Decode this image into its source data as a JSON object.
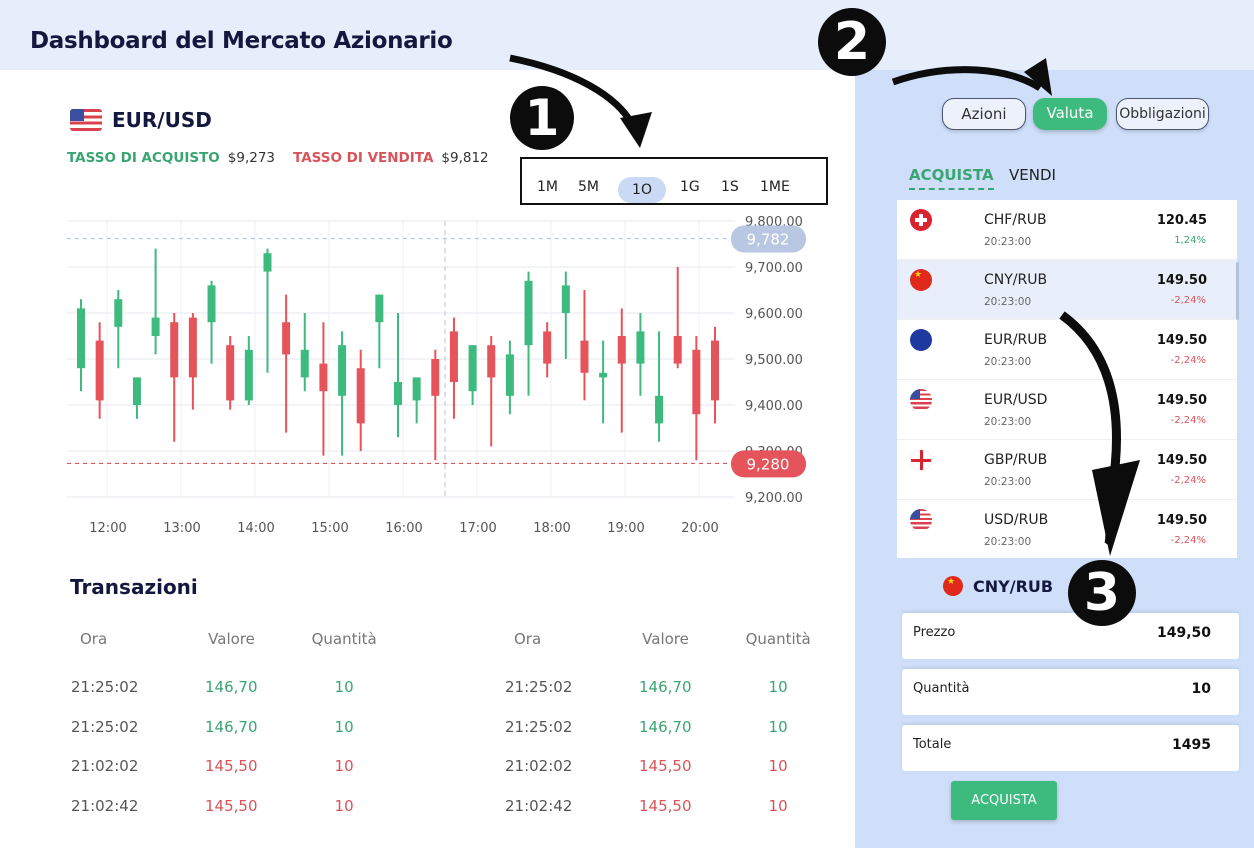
{
  "app": {
    "title": "Dashboard del Mercato Azionario"
  },
  "pair": {
    "name": "EUR/USD",
    "flag_icon": "us-flag-icon",
    "buy_label": "TASSO DI ACQUISTO",
    "buy_value": "$9,273",
    "sell_label": "TASSO DI VENDITA",
    "sell_value": "$9,812"
  },
  "timeframes": [
    {
      "label": "1M"
    },
    {
      "label": "5M"
    },
    {
      "label": "1O",
      "active": true
    },
    {
      "label": "1G"
    },
    {
      "label": "1S"
    },
    {
      "label": "1ME"
    }
  ],
  "chart_data": {
    "type": "candlestick",
    "x_tick_labels": [
      "12:00",
      "13:00",
      "14:00",
      "15:00",
      "16:00",
      "17:00",
      "18:00",
      "19:00",
      "20:00"
    ],
    "y_tick_labels": [
      "9,800.00",
      "9,700.00",
      "9,600.00",
      "9,500.00",
      "9,400.00",
      "9,300.00",
      "9,200.00"
    ],
    "ylim": [
      9200,
      9800
    ],
    "up_color": "#3dba7e",
    "down_color": "#e4545a",
    "price_markers": [
      {
        "label": "9,782",
        "value": 9762,
        "color": "#b9c8e2"
      },
      {
        "label": "9,280",
        "value": 9273,
        "color": "#e4545a"
      }
    ],
    "candles": [
      {
        "o": 9480,
        "h": 9630,
        "l": 9430,
        "c": 9610
      },
      {
        "o": 9540,
        "h": 9580,
        "l": 9370,
        "c": 9410
      },
      {
        "o": 9570,
        "h": 9650,
        "l": 9480,
        "c": 9630
      },
      {
        "o": 9400,
        "h": 9460,
        "l": 9370,
        "c": 9460
      },
      {
        "o": 9550,
        "h": 9740,
        "l": 9510,
        "c": 9590
      },
      {
        "o": 9580,
        "h": 9600,
        "l": 9320,
        "c": 9460
      },
      {
        "o": 9590,
        "h": 9600,
        "l": 9390,
        "c": 9460
      },
      {
        "o": 9580,
        "h": 9670,
        "l": 9490,
        "c": 9660
      },
      {
        "o": 9530,
        "h": 9550,
        "l": 9390,
        "c": 9410
      },
      {
        "o": 9410,
        "h": 9550,
        "l": 9400,
        "c": 9520
      },
      {
        "o": 9690,
        "h": 9740,
        "l": 9470,
        "c": 9730
      },
      {
        "o": 9580,
        "h": 9640,
        "l": 9340,
        "c": 9510
      },
      {
        "o": 9460,
        "h": 9600,
        "l": 9430,
        "c": 9520
      },
      {
        "o": 9490,
        "h": 9580,
        "l": 9290,
        "c": 9430
      },
      {
        "o": 9420,
        "h": 9560,
        "l": 9290,
        "c": 9530
      },
      {
        "o": 9480,
        "h": 9520,
        "l": 9300,
        "c": 9360
      },
      {
        "o": 9580,
        "h": 9640,
        "l": 9480,
        "c": 9640
      },
      {
        "o": 9400,
        "h": 9600,
        "l": 9330,
        "c": 9450
      },
      {
        "o": 9410,
        "h": 9440,
        "l": 9360,
        "c": 9460
      },
      {
        "o": 9500,
        "h": 9520,
        "l": 9280,
        "c": 9420
      },
      {
        "o": 9560,
        "h": 9590,
        "l": 9370,
        "c": 9450
      },
      {
        "o": 9430,
        "h": 9530,
        "l": 9400,
        "c": 9530
      },
      {
        "o": 9530,
        "h": 9550,
        "l": 9310,
        "c": 9460
      },
      {
        "o": 9420,
        "h": 9540,
        "l": 9380,
        "c": 9510
      },
      {
        "o": 9530,
        "h": 9690,
        "l": 9420,
        "c": 9670
      },
      {
        "o": 9560,
        "h": 9580,
        "l": 9460,
        "c": 9490
      },
      {
        "o": 9600,
        "h": 9690,
        "l": 9500,
        "c": 9660
      },
      {
        "o": 9540,
        "h": 9650,
        "l": 9410,
        "c": 9470
      },
      {
        "o": 9460,
        "h": 9540,
        "l": 9360,
        "c": 9470
      },
      {
        "o": 9550,
        "h": 9610,
        "l": 9340,
        "c": 9490
      },
      {
        "o": 9490,
        "h": 9600,
        "l": 9420,
        "c": 9560
      },
      {
        "o": 9360,
        "h": 9560,
        "l": 9320,
        "c": 9420
      },
      {
        "o": 9550,
        "h": 9700,
        "l": 9480,
        "c": 9490
      },
      {
        "o": 9520,
        "h": 9550,
        "l": 9280,
        "c": 9380
      },
      {
        "o": 9540,
        "h": 9570,
        "l": 9360,
        "c": 9410
      }
    ]
  },
  "transactions": {
    "title": "Transazioni",
    "headers": [
      "Ora",
      "Valore",
      "Quantità"
    ],
    "rows": [
      {
        "time": "21:25:02",
        "value": "146,70",
        "qty": "10",
        "side": "buy"
      },
      {
        "time": "21:25:02",
        "value": "146,70",
        "qty": "10",
        "side": "buy"
      },
      {
        "time": "21:02:02",
        "value": "145,50",
        "qty": "10",
        "side": "sell"
      },
      {
        "time": "21:02:42",
        "value": "145,50",
        "qty": "10",
        "side": "sell"
      }
    ]
  },
  "asset_tabs": [
    {
      "label": "Azioni",
      "active": false
    },
    {
      "label": "Valuta",
      "active": true
    },
    {
      "label": "Obbligazioni",
      "active": false
    }
  ],
  "trade_tabs": {
    "buy": "ACQUISTA",
    "sell": "VENDI"
  },
  "currencies": [
    {
      "pair": "CHF/RUB",
      "time": "20:23:00",
      "price": "120.45",
      "change": "1,24%",
      "dir": "up",
      "flag": "f-ch"
    },
    {
      "pair": "CNY/RUB",
      "time": "20:23:00",
      "price": "149.50",
      "change": "-2,24%",
      "dir": "down",
      "flag": "f-cn",
      "selected": true
    },
    {
      "pair": "EUR/RUB",
      "time": "20:23:00",
      "price": "149.50",
      "change": "-2,24%",
      "dir": "down",
      "flag": "f-eu"
    },
    {
      "pair": "EUR/USD",
      "time": "20:23:00",
      "price": "149.50",
      "change": "-2,24%",
      "dir": "down",
      "flag": "f-us"
    },
    {
      "pair": "GBP/RUB",
      "time": "20:23:00",
      "price": "149.50",
      "change": "-2,24%",
      "dir": "down",
      "flag": "f-gb"
    },
    {
      "pair": "USD/RUB",
      "time": "20:23:00",
      "price": "149.50",
      "change": "-2,24%",
      "dir": "down",
      "flag": "f-us"
    }
  ],
  "order": {
    "pair": "CNY/RUB",
    "price_label": "Prezzo",
    "price_value": "149,50",
    "qty_label": "Quantità",
    "qty_value": "10",
    "total_label": "Totale",
    "total_value": "1495",
    "submit_label": "ACQUISTA"
  },
  "markers": [
    "1",
    "2",
    "3"
  ]
}
